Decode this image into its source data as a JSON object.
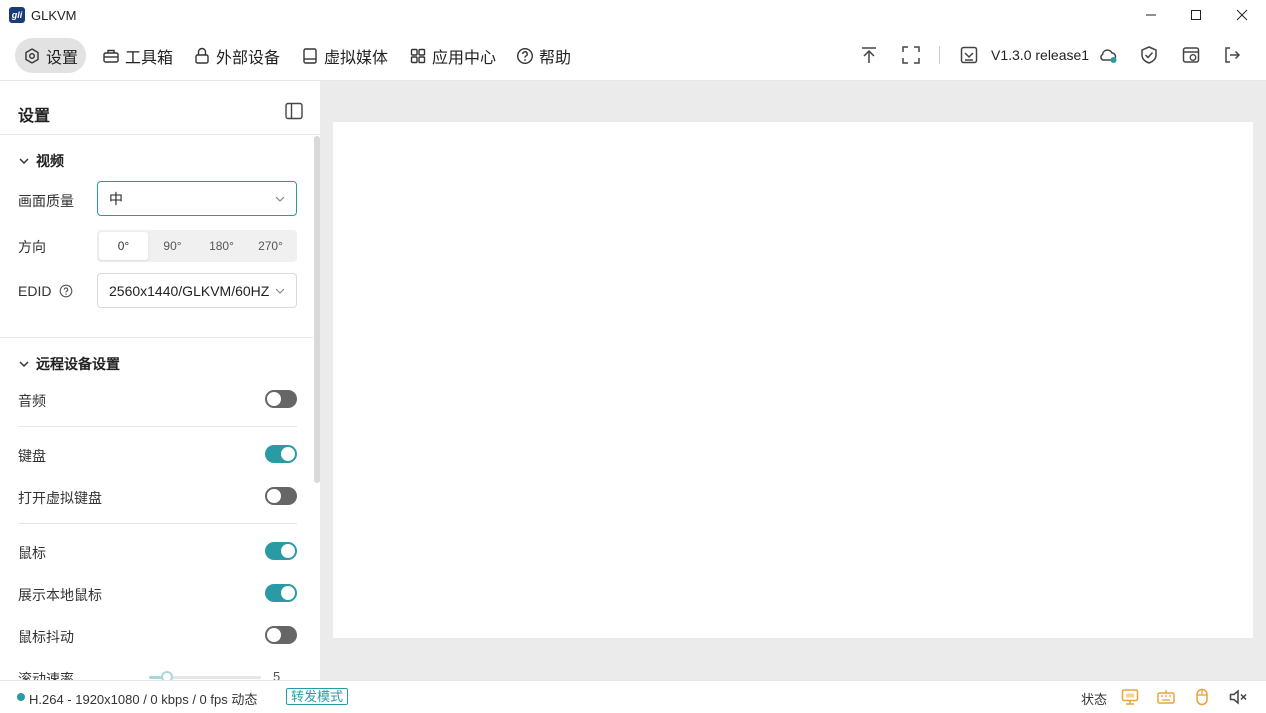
{
  "window": {
    "title": "GLKVM",
    "logo_text": "gli"
  },
  "nav": {
    "items": [
      {
        "label": "设置",
        "icon": "gear-icon",
        "active": true
      },
      {
        "label": "工具箱",
        "icon": "toolbox-icon",
        "active": false
      },
      {
        "label": "外部设备",
        "icon": "lock-device-icon",
        "active": false
      },
      {
        "label": "虚拟媒体",
        "icon": "drive-icon",
        "active": false
      },
      {
        "label": "应用中心",
        "icon": "apps-icon",
        "active": false
      },
      {
        "label": "帮助",
        "icon": "help-icon",
        "active": false
      }
    ],
    "version": "V1.3.0 release1"
  },
  "sidebar": {
    "title": "设置",
    "video": {
      "heading": "视频",
      "quality_label": "画面质量",
      "quality_value": "中",
      "orientation_label": "方向",
      "orientation_options": [
        "0°",
        "90°",
        "180°",
        "270°"
      ],
      "orientation_selected": "0°",
      "edid_label": "EDID",
      "edid_value": "2560x1440/GLKVM/60HZ"
    },
    "remote": {
      "heading": "远程设备设置",
      "audio_label": "音频",
      "audio_on": false,
      "keyboard_label": "键盘",
      "keyboard_on": true,
      "virtual_keyboard_label": "打开虚拟键盘",
      "virtual_keyboard_on": false,
      "mouse_label": "鼠标",
      "mouse_on": true,
      "local_mouse_label": "展示本地鼠标",
      "local_mouse_on": true,
      "mouse_jiggle_label": "鼠标抖动",
      "mouse_jiggle_on": false,
      "scroll_speed_label": "滚动速率",
      "scroll_speed_value": "5"
    }
  },
  "status": {
    "stream_info": "H.264 - 1920x1080 /  0 kbps / 0 fps 动态",
    "mode_badge": "转发模式",
    "state_label": "状态",
    "accent_color": "#2a9ba5",
    "warning_color": "#e8a33a"
  }
}
